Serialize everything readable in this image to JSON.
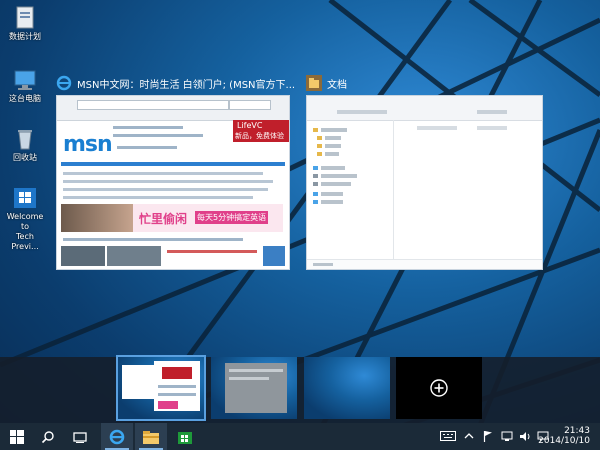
{
  "desktop": {
    "icons": [
      {
        "label": "数据计划"
      },
      {
        "label": "这台电脑"
      },
      {
        "label": "回收站"
      },
      {
        "label_line1": "Welcome to",
        "label_line2": "Tech Previ..."
      }
    ]
  },
  "task_view": {
    "windows": [
      {
        "title": "MSN中文网：时尚生活 白领门户; (MSN官方下...",
        "icon": "ie-icon",
        "ad_text_1": "LifeVC",
        "ad_text_2": "新品，免费体验",
        "banner_text_1": "忙里偷闲",
        "banner_text_2": "每天5分钟搞定英语",
        "logo": "msn"
      },
      {
        "title": "文档",
        "icon": "folder-icon"
      }
    ]
  },
  "virtual_desktops": {
    "add_button": "new-desktop-plus-icon"
  },
  "taskbar": {
    "items": [
      {
        "name": "start",
        "icon": "windows-logo-icon"
      },
      {
        "name": "search",
        "icon": "search-icon"
      },
      {
        "name": "task-view",
        "icon": "task-view-icon"
      },
      {
        "name": "internet-explorer",
        "icon": "ie-icon"
      },
      {
        "name": "file-explorer",
        "icon": "folder-icon"
      },
      {
        "name": "store",
        "icon": "store-icon"
      }
    ],
    "tray_icons": [
      "keyboard-icon",
      "chevron-up-icon",
      "flag-icon",
      "network-icon",
      "volume-icon",
      "notification-icon"
    ],
    "time": "21:43",
    "date": "2014/10/10"
  },
  "colors": {
    "accent": "#2c7fd0",
    "taskbar": "#1b2a38",
    "wallpaper": "#15619f"
  }
}
